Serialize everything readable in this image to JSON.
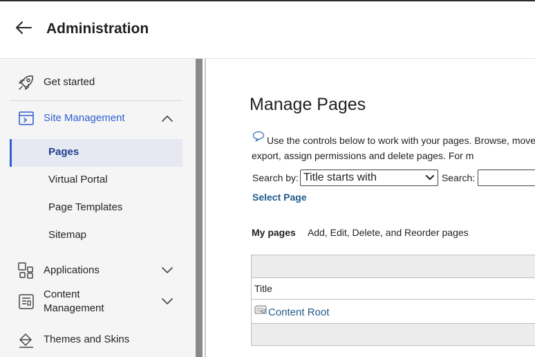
{
  "header": {
    "title": "Administration"
  },
  "sidebar": {
    "items": [
      {
        "label": "Get started",
        "icon": "rocket-icon"
      },
      {
        "label": "Site Management",
        "icon": "site-management-icon",
        "expanded": true,
        "children": [
          {
            "label": "Pages",
            "active": true
          },
          {
            "label": "Virtual Portal"
          },
          {
            "label": "Page Templates"
          },
          {
            "label": "Sitemap"
          }
        ]
      },
      {
        "label": "Applications",
        "icon": "applications-grid-icon"
      },
      {
        "label": "Content\nManagement",
        "icon": "content-management-icon"
      },
      {
        "label": "Themes and Skins",
        "icon": "paint-bucket-icon"
      }
    ]
  },
  "main": {
    "title": "Manage Pages",
    "help_text": "Use the controls below to work with your pages. Browse, move, export, assign permissions and delete pages. For m",
    "search": {
      "by_label": "Search by:",
      "by_value": "Title starts with",
      "search_label": "Search:",
      "search_value": ""
    },
    "select_page": "Select Page",
    "tabs": {
      "mine": "My pages",
      "other": "Add, Edit, Delete, and Reorder pages"
    },
    "table": {
      "column": "Title",
      "rows": [
        {
          "title": "Content Root"
        }
      ]
    }
  },
  "colors": {
    "accent": "#2e5fcf",
    "link": "#1f5a8a",
    "sidebar_bg": "#f5f5f5"
  }
}
